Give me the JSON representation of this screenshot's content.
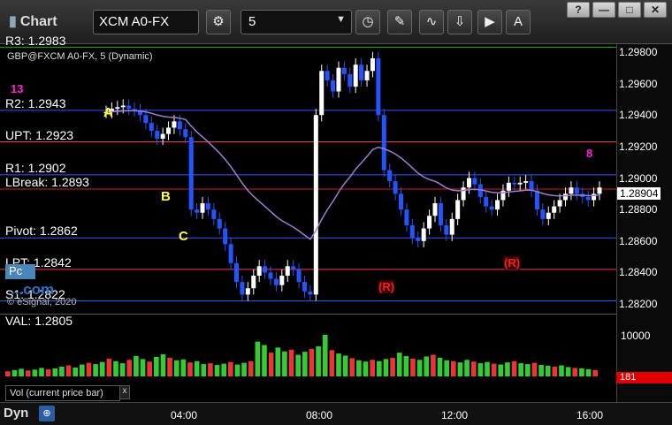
{
  "window": {
    "title": "Chart",
    "symbol": "XCM A0-FX",
    "interval": "5",
    "buttons": {
      "help": "?",
      "minimize": "—",
      "maximize": "□",
      "close": "✕"
    }
  },
  "study_label": "GBP@FXCM A0-FX, 5 (Dynamic)",
  "levels": [
    {
      "name": "R3",
      "label": "R3: 1.2983",
      "price": 1.2983,
      "color": "#00c000"
    },
    {
      "name": "R2",
      "label": "R2: 1.2943",
      "price": 1.2943,
      "color": "#3355ff"
    },
    {
      "name": "UPT",
      "label": "UPT: 1.2923",
      "price": 1.2923,
      "color": "#ff3366"
    },
    {
      "name": "R1",
      "label": "R1: 1.2902",
      "price": 1.2902,
      "color": "#3355ff"
    },
    {
      "name": "LBreak",
      "label": "LBreak: 1.2893",
      "price": 1.2893,
      "color": "#cc2222"
    },
    {
      "name": "Pivot",
      "label": "Pivot: 1.2862",
      "price": 1.2862,
      "color": "#3355ff"
    },
    {
      "name": "LPT",
      "label": "LPT: 1.2842",
      "price": 1.2842,
      "color": "#ff3366"
    },
    {
      "name": "S1",
      "label": "S1: 1.2822",
      "price": 1.2822,
      "color": "#3355ff"
    },
    {
      "name": "VAL",
      "label": "VAL: 1.2805",
      "price": 1.2805,
      "color": "#888888"
    }
  ],
  "price_axis": {
    "ticks": [
      "1.29800",
      "1.29600",
      "1.29400",
      "1.29200",
      "1.29000",
      "1.28800",
      "1.28600",
      "1.28400",
      "1.28200"
    ],
    "current": "1.28904"
  },
  "annotations": {
    "A": "A",
    "B": "B",
    "C": "C",
    "R1": "(R)",
    "R2": "(R)",
    "n13": "13",
    "n8": "8"
  },
  "badge": "Pc",
  "watermark": "...com",
  "copyright": "© eSignal, 2020",
  "volume": {
    "label": "Vol (current price bar)",
    "close": "x",
    "tick": "10000",
    "current": "181"
  },
  "time_axis": {
    "dyn": "Dyn",
    "ticks": [
      "04:00",
      "08:00",
      "12:00",
      "16:00"
    ]
  },
  "chart_data": {
    "type": "candlestick",
    "xlabels": [
      "04:00",
      "08:00",
      "12:00",
      "16:00"
    ],
    "ylim": [
      1.2815,
      1.2985
    ],
    "close": [
      1.2942,
      1.2944,
      1.2945,
      1.2946,
      1.2944,
      1.2943,
      1.294,
      1.2935,
      1.293,
      1.2925,
      1.2928,
      1.2932,
      1.2936,
      1.2931,
      1.2926,
      1.288,
      1.2878,
      1.2884,
      1.288,
      1.2874,
      1.2868,
      1.2858,
      1.2846,
      1.2834,
      1.2826,
      1.283,
      1.2838,
      1.2844,
      1.284,
      1.2836,
      1.2832,
      1.2838,
      1.2844,
      1.2842,
      1.2834,
      1.2828,
      1.2826,
      1.294,
      1.2968,
      1.2962,
      1.2955,
      1.297,
      1.2966,
      1.2958,
      1.2972,
      1.2962,
      1.2968,
      1.2976,
      1.294,
      1.2905,
      1.2898,
      1.289,
      1.288,
      1.287,
      1.2862,
      1.286,
      1.2868,
      1.2876,
      1.2884,
      1.287,
      1.2864,
      1.2874,
      1.2886,
      1.2894,
      1.29,
      1.2896,
      1.2888,
      1.2882,
      1.288,
      1.2886,
      1.2892,
      1.2897,
      1.2896,
      1.2897,
      1.2898,
      1.2892,
      1.288,
      1.2874,
      1.2878,
      1.2882,
      1.2886,
      1.289,
      1.2894,
      1.289,
      1.2888,
      1.2886,
      1.289,
      1.2894
    ],
    "volume": [
      1200,
      1500,
      1800,
      1400,
      1600,
      2000,
      1700,
      1900,
      2300,
      2600,
      2100,
      2800,
      3200,
      2900,
      3400,
      4200,
      3600,
      3100,
      3900,
      4800,
      4100,
      3500,
      4600,
      5200,
      4400,
      3800,
      4000,
      3300,
      3600,
      2900,
      3100,
      2700,
      3000,
      3400,
      2800,
      3200,
      3600,
      8200,
      7400,
      5600,
      6800,
      5900,
      6300,
      5100,
      5800,
      6500,
      7100,
      9800,
      6200,
      5400,
      4900,
      4300,
      3800,
      3500,
      3900,
      3600,
      4100,
      4400,
      5600,
      4800,
      4200,
      3900,
      4700,
      5100,
      4400,
      3800,
      3600,
      3300,
      3900,
      3500,
      3100,
      3400,
      3000,
      2800,
      3300,
      3600,
      3100,
      2900,
      3200,
      2700,
      2500,
      2300,
      2600,
      2200,
      2000,
      1900,
      1700,
      1500
    ]
  }
}
